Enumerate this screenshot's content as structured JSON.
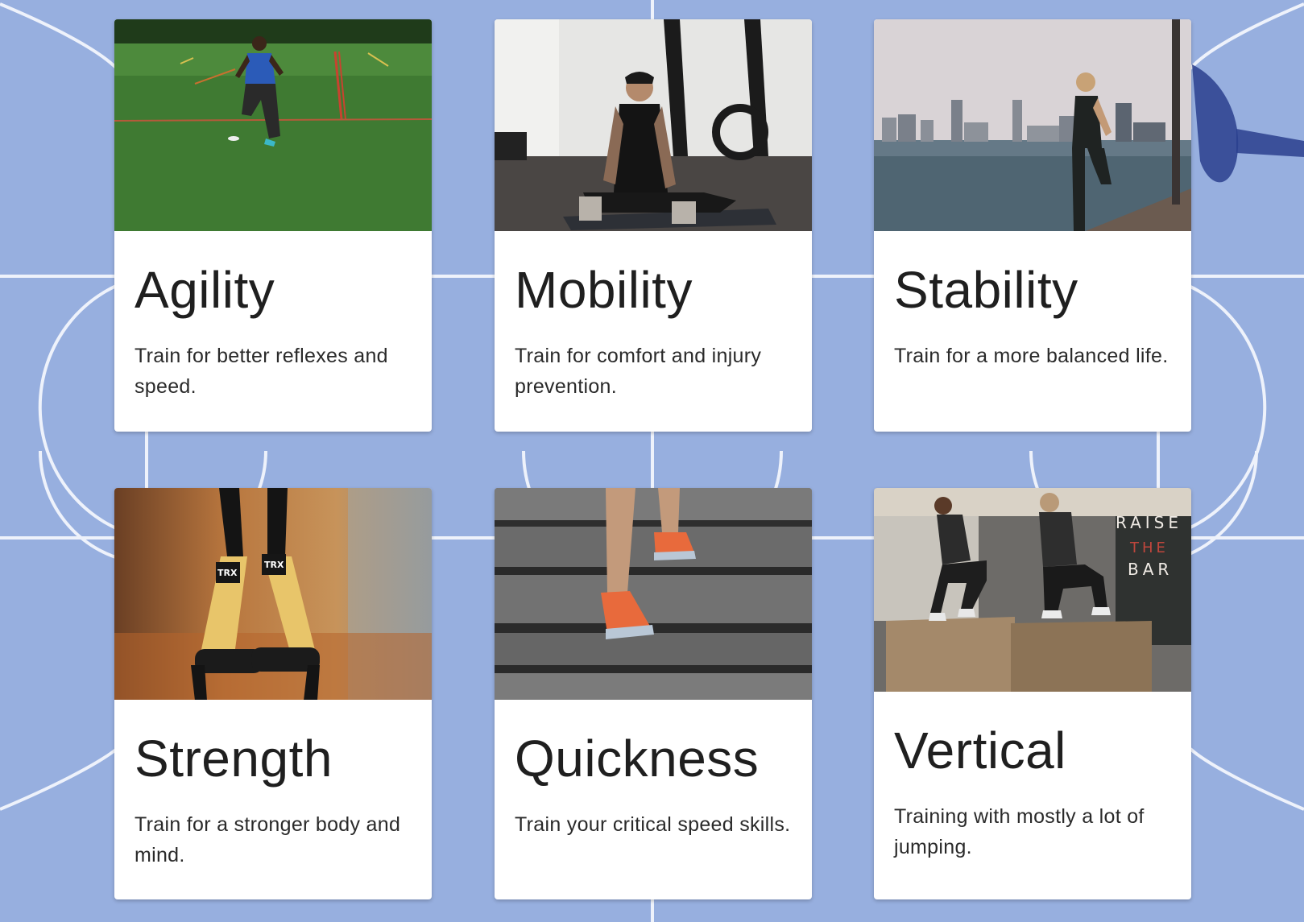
{
  "cards": [
    {
      "title": "Agility",
      "description": "Train for better reflexes and speed.",
      "image": "sprinter-on-field-photo"
    },
    {
      "title": "Mobility",
      "description": "Train for comfort and injury prevention.",
      "image": "man-stretching-on-mat-photo"
    },
    {
      "title": "Stability",
      "description": "Train for a more balanced life.",
      "image": "woman-by-harbor-photo"
    },
    {
      "title": "Strength",
      "description": "Train for a stronger body and mind.",
      "image": "suspension-straps-photo"
    },
    {
      "title": "Quickness",
      "description": "Train your critical speed skills.",
      "image": "runner-on-stairs-photo"
    },
    {
      "title": "Vertical",
      "description": "Training with mostly a lot of jumping.",
      "image": "box-jump-photo"
    }
  ],
  "gym_wall_text": [
    "RAISE",
    "THE",
    "BAR"
  ],
  "equipment_brand": "TRX",
  "colors": {
    "background": "#9bb2e0",
    "court_lines": "#eef2fb",
    "card": "#ffffff",
    "title_text": "#1f1f1f",
    "body_text": "#2a2a2a"
  }
}
